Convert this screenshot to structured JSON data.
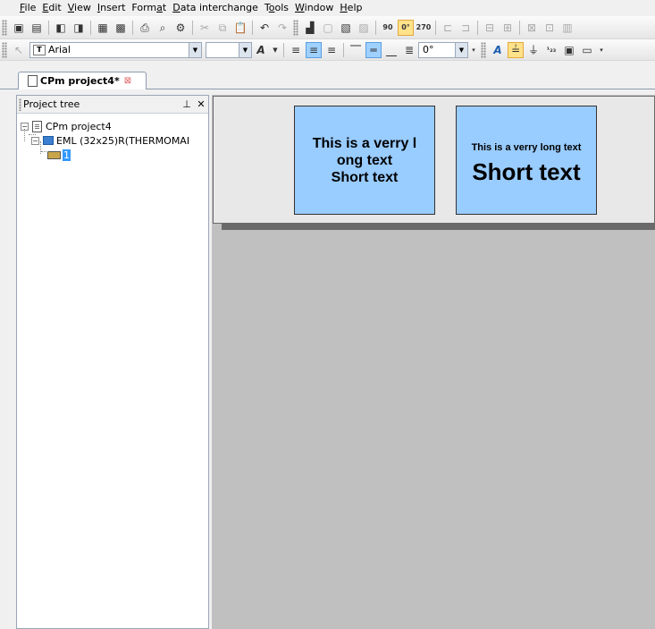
{
  "menu": [
    {
      "pre": "",
      "u": "F",
      "post": "ile"
    },
    {
      "pre": "",
      "u": "E",
      "post": "dit"
    },
    {
      "pre": "",
      "u": "V",
      "post": "iew"
    },
    {
      "pre": "",
      "u": "I",
      "post": "nsert"
    },
    {
      "pre": "Form",
      "u": "a",
      "post": "t"
    },
    {
      "pre": "",
      "u": "D",
      "post": "ata interchange"
    },
    {
      "pre": "T",
      "u": "o",
      "post": "ols"
    },
    {
      "pre": "",
      "u": "W",
      "post": "indow"
    },
    {
      "pre": "",
      "u": "H",
      "post": "elp"
    }
  ],
  "toolbar2": {
    "font_name": "Arial",
    "font_size": "",
    "rotation": "0°",
    "rotate_90": "90",
    "rotate_0": "0°",
    "rotate_270": "270",
    "sub_sup": "¹₂₃"
  },
  "tab": {
    "label": "CPm project4*"
  },
  "project_tree": {
    "title": "Project tree",
    "root": "CPm project4",
    "label_node": "EML (32x25)R(THERMOMAI",
    "item_node": "1"
  },
  "canvas": {
    "box1_text": "This is a verry l\nong text\nShort text",
    "box2_small": "This is a verry long text",
    "box2_big": "Short text"
  },
  "colors": {
    "text_box_fill": "#99ccff",
    "canvas_bg": "#c0c0c0",
    "selection": "#3399ff"
  }
}
